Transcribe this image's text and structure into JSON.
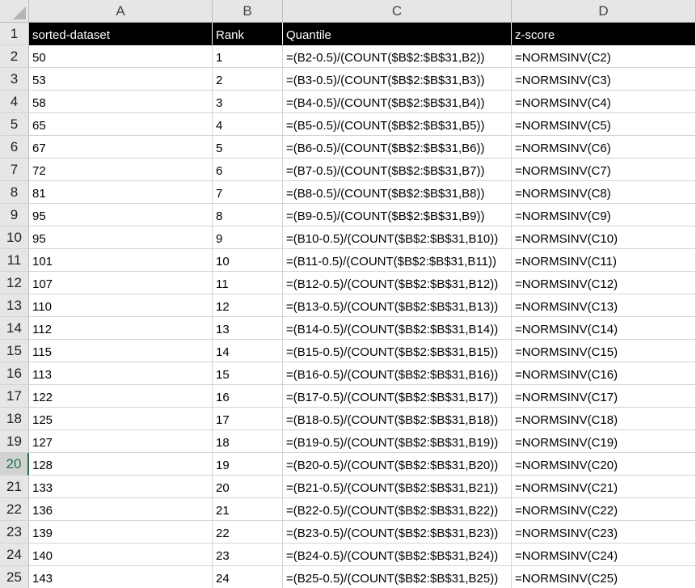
{
  "sheet": {
    "columns": [
      "A",
      "B",
      "C",
      "D"
    ],
    "headers": [
      "sorted-dataset",
      "Rank",
      "Quantile",
      "z-score"
    ],
    "active_row": 20,
    "rows": [
      {
        "num": "2",
        "a": "50",
        "b": "1",
        "c": "=(B2-0.5)/(COUNT($B$2:$B$31,B2))",
        "d": "=NORMSINV(C2)"
      },
      {
        "num": "3",
        "a": "53",
        "b": "2",
        "c": "=(B3-0.5)/(COUNT($B$2:$B$31,B3))",
        "d": "=NORMSINV(C3)"
      },
      {
        "num": "4",
        "a": "58",
        "b": "3",
        "c": "=(B4-0.5)/(COUNT($B$2:$B$31,B4))",
        "d": "=NORMSINV(C4)"
      },
      {
        "num": "5",
        "a": "65",
        "b": "4",
        "c": "=(B5-0.5)/(COUNT($B$2:$B$31,B5))",
        "d": "=NORMSINV(C5)"
      },
      {
        "num": "6",
        "a": "67",
        "b": "5",
        "c": "=(B6-0.5)/(COUNT($B$2:$B$31,B6))",
        "d": "=NORMSINV(C6)"
      },
      {
        "num": "7",
        "a": "72",
        "b": "6",
        "c": "=(B7-0.5)/(COUNT($B$2:$B$31,B7))",
        "d": "=NORMSINV(C7)"
      },
      {
        "num": "8",
        "a": "81",
        "b": "7",
        "c": "=(B8-0.5)/(COUNT($B$2:$B$31,B8))",
        "d": "=NORMSINV(C8)"
      },
      {
        "num": "9",
        "a": "95",
        "b": "8",
        "c": "=(B9-0.5)/(COUNT($B$2:$B$31,B9))",
        "d": "=NORMSINV(C9)"
      },
      {
        "num": "10",
        "a": "95",
        "b": "9",
        "c": "=(B10-0.5)/(COUNT($B$2:$B$31,B10))",
        "d": "=NORMSINV(C10)"
      },
      {
        "num": "11",
        "a": "101",
        "b": "10",
        "c": "=(B11-0.5)/(COUNT($B$2:$B$31,B11))",
        "d": "=NORMSINV(C11)"
      },
      {
        "num": "12",
        "a": "107",
        "b": "11",
        "c": "=(B12-0.5)/(COUNT($B$2:$B$31,B12))",
        "d": "=NORMSINV(C12)"
      },
      {
        "num": "13",
        "a": "110",
        "b": "12",
        "c": "=(B13-0.5)/(COUNT($B$2:$B$31,B13))",
        "d": "=NORMSINV(C13)"
      },
      {
        "num": "14",
        "a": "112",
        "b": "13",
        "c": "=(B14-0.5)/(COUNT($B$2:$B$31,B14))",
        "d": "=NORMSINV(C14)"
      },
      {
        "num": "15",
        "a": "115",
        "b": "14",
        "c": "=(B15-0.5)/(COUNT($B$2:$B$31,B15))",
        "d": "=NORMSINV(C15)"
      },
      {
        "num": "16",
        "a": "113",
        "b": "15",
        "c": "=(B16-0.5)/(COUNT($B$2:$B$31,B16))",
        "d": "=NORMSINV(C16)"
      },
      {
        "num": "17",
        "a": "122",
        "b": "16",
        "c": "=(B17-0.5)/(COUNT($B$2:$B$31,B17))",
        "d": "=NORMSINV(C17)"
      },
      {
        "num": "18",
        "a": "125",
        "b": "17",
        "c": "=(B18-0.5)/(COUNT($B$2:$B$31,B18))",
        "d": "=NORMSINV(C18)"
      },
      {
        "num": "19",
        "a": "127",
        "b": "18",
        "c": "=(B19-0.5)/(COUNT($B$2:$B$31,B19))",
        "d": "=NORMSINV(C19)"
      },
      {
        "num": "20",
        "a": "128",
        "b": "19",
        "c": "=(B20-0.5)/(COUNT($B$2:$B$31,B20))",
        "d": "=NORMSINV(C20)"
      },
      {
        "num": "21",
        "a": "133",
        "b": "20",
        "c": "=(B21-0.5)/(COUNT($B$2:$B$31,B21))",
        "d": "=NORMSINV(C21)"
      },
      {
        "num": "22",
        "a": "136",
        "b": "21",
        "c": "=(B22-0.5)/(COUNT($B$2:$B$31,B22))",
        "d": "=NORMSINV(C22)"
      },
      {
        "num": "23",
        "a": "139",
        "b": "22",
        "c": "=(B23-0.5)/(COUNT($B$2:$B$31,B23))",
        "d": "=NORMSINV(C23)"
      },
      {
        "num": "24",
        "a": "140",
        "b": "23",
        "c": "=(B24-0.5)/(COUNT($B$2:$B$31,B24))",
        "d": "=NORMSINV(C24)"
      },
      {
        "num": "25",
        "a": "143",
        "b": "24",
        "c": "=(B25-0.5)/(COUNT($B$2:$B$31,B25))",
        "d": "=NORMSINV(C25)"
      }
    ]
  }
}
